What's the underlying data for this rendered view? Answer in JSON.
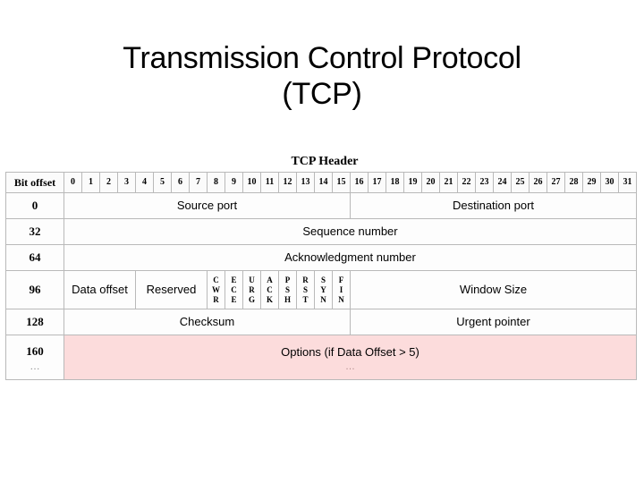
{
  "slide": {
    "title_line1": "Transmission Control Protocol",
    "title_line2": "(TCP)"
  },
  "diagram": {
    "caption": "TCP Header",
    "bit_offset_header": "Bit offset",
    "bit_numbers": [
      "0",
      "1",
      "2",
      "3",
      "4",
      "5",
      "6",
      "7",
      "8",
      "9",
      "10",
      "11",
      "12",
      "13",
      "14",
      "15",
      "16",
      "17",
      "18",
      "19",
      "20",
      "21",
      "22",
      "23",
      "24",
      "25",
      "26",
      "27",
      "28",
      "29",
      "30",
      "31"
    ],
    "options_row_color": "#fcdcdc",
    "rows": [
      {
        "offset": "0",
        "offset_suffix": "",
        "cells": [
          {
            "label": "Source port",
            "bits": 16
          },
          {
            "label": "Destination port",
            "bits": 16
          }
        ]
      },
      {
        "offset": "32",
        "offset_suffix": "",
        "cells": [
          {
            "label": "Sequence number",
            "bits": 32
          }
        ]
      },
      {
        "offset": "64",
        "offset_suffix": "",
        "cells": [
          {
            "label": "Acknowledgment number",
            "bits": 32
          }
        ]
      },
      {
        "offset": "96",
        "offset_suffix": "",
        "cells": [
          {
            "label": "Data offset",
            "bits": 4
          },
          {
            "label": "Reserved",
            "bits": 4
          },
          {
            "label": "CWR",
            "bits": 1,
            "flag": true
          },
          {
            "label": "ECE",
            "bits": 1,
            "flag": true
          },
          {
            "label": "URG",
            "bits": 1,
            "flag": true
          },
          {
            "label": "ACK",
            "bits": 1,
            "flag": true
          },
          {
            "label": "PSH",
            "bits": 1,
            "flag": true
          },
          {
            "label": "RST",
            "bits": 1,
            "flag": true
          },
          {
            "label": "SYN",
            "bits": 1,
            "flag": true
          },
          {
            "label": "FIN",
            "bits": 1,
            "flag": true
          },
          {
            "label": "Window Size",
            "bits": 16
          }
        ]
      },
      {
        "offset": "128",
        "offset_suffix": "",
        "cells": [
          {
            "label": "Checksum",
            "bits": 16
          },
          {
            "label": "Urgent pointer",
            "bits": 16
          }
        ]
      },
      {
        "offset": "160",
        "offset_suffix": "…",
        "options": true,
        "cells": [
          {
            "label": "Options (if Data Offset > 5)",
            "sublabel": "…",
            "bits": 32
          }
        ]
      }
    ]
  }
}
